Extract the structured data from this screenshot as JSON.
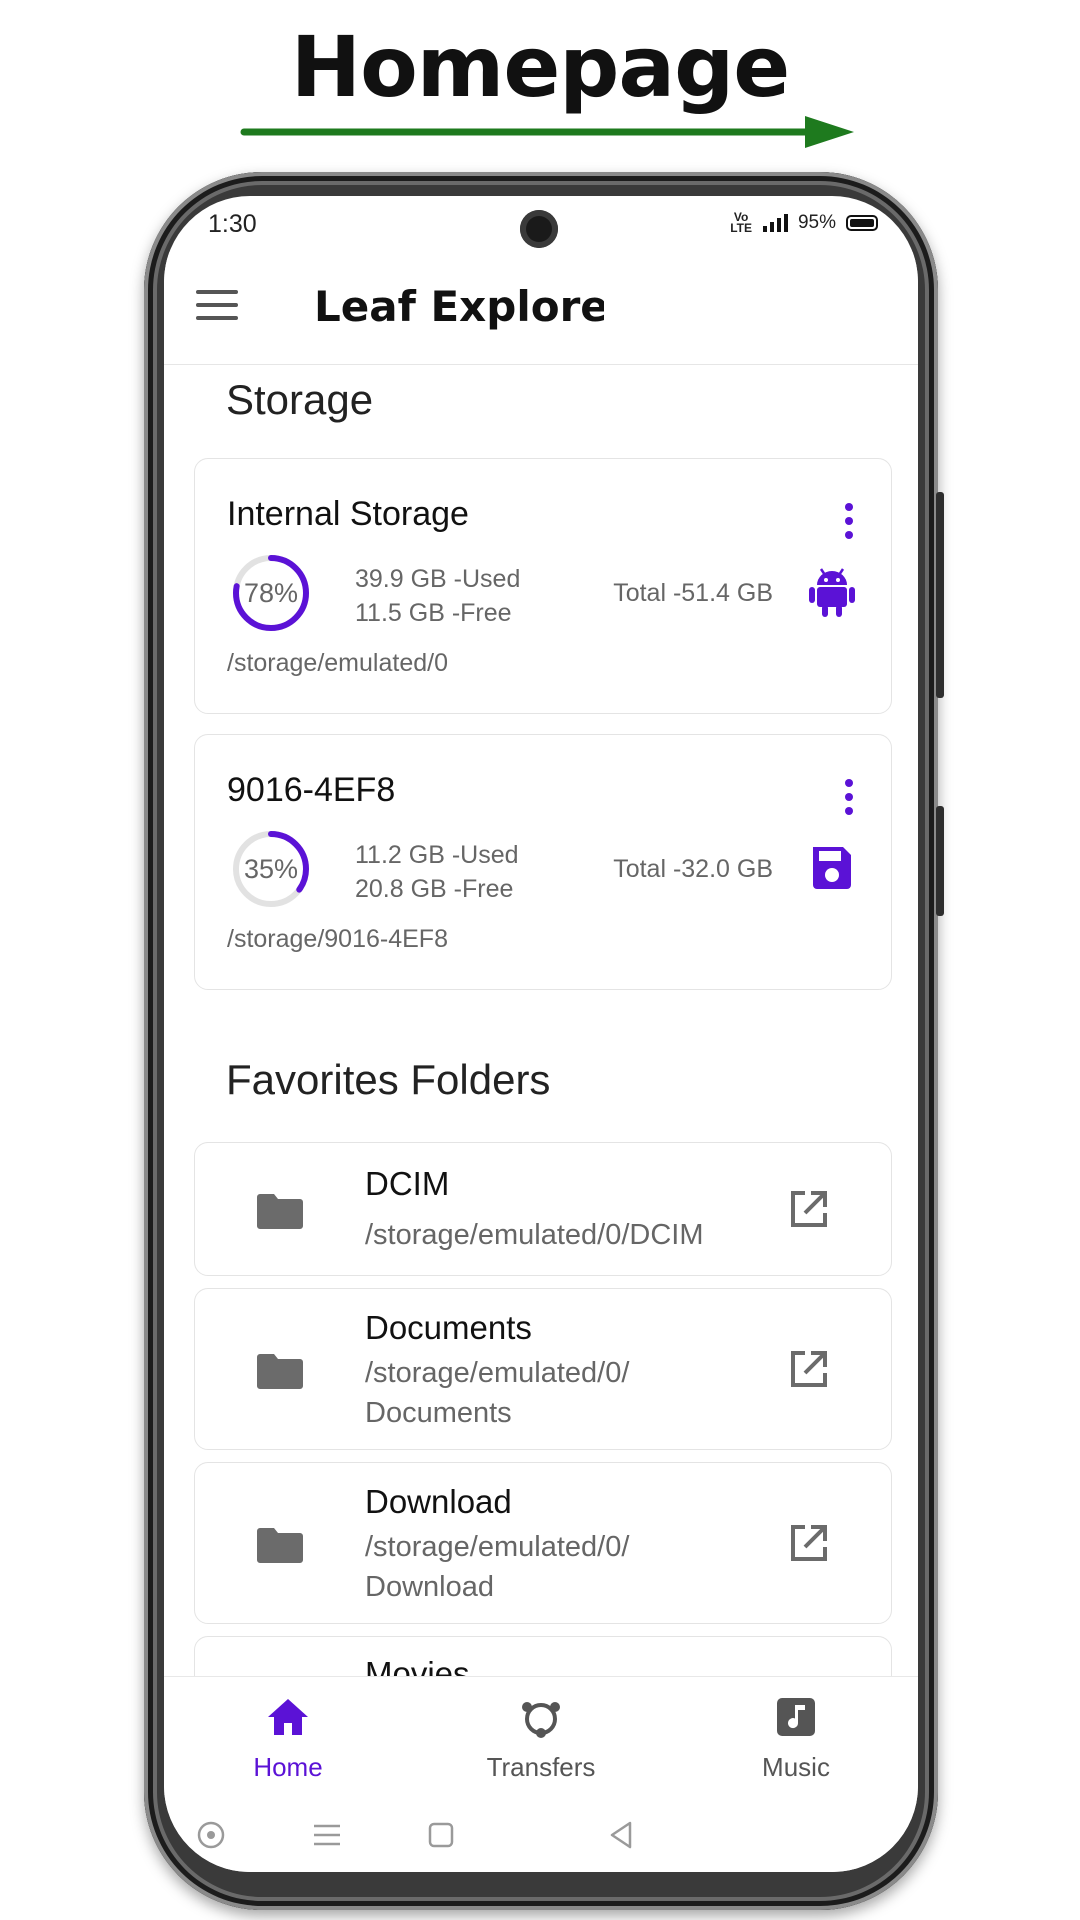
{
  "caption": "Homepage",
  "status": {
    "time": "1:30",
    "volte": "Vo LTE",
    "battery": "95%"
  },
  "appbar": {
    "title": "Leaf Explorer"
  },
  "storage": {
    "heading": "Storage",
    "cards": [
      {
        "name": "Internal Storage",
        "percent": "78%",
        "percent_value": 78,
        "used": "39.9 GB -Used",
        "free": "11.5 GB -Free",
        "total": "Total -51.4 GB",
        "path": "/storage/emulated/0",
        "icon": "android-icon"
      },
      {
        "name": "9016-4EF8",
        "percent": "35%",
        "percent_value": 35,
        "used": "11.2 GB -Used",
        "free": "20.8 GB -Free",
        "total": "Total -32.0 GB",
        "path": "/storage/9016-4EF8",
        "icon": "sd-card-icon"
      }
    ]
  },
  "favorites": {
    "heading": "Favorites Folders",
    "items": [
      {
        "name": "DCIM",
        "path_line1": "/storage/emulated/0/DCIM",
        "path_line2": ""
      },
      {
        "name": "Documents",
        "path_line1": "/storage/emulated/0/",
        "path_line2": "Documents"
      },
      {
        "name": "Download",
        "path_line1": "/storage/emulated/0/",
        "path_line2": "Download"
      },
      {
        "name": "Movies",
        "path_line1": "",
        "path_line2": ""
      }
    ]
  },
  "bottom_nav": {
    "home": "Home",
    "transfers": "Transfers",
    "music": "Music"
  },
  "colors": {
    "accent": "#5b12d6",
    "arrow": "#1e7a1e",
    "text": "#111111",
    "muted": "#666666"
  }
}
